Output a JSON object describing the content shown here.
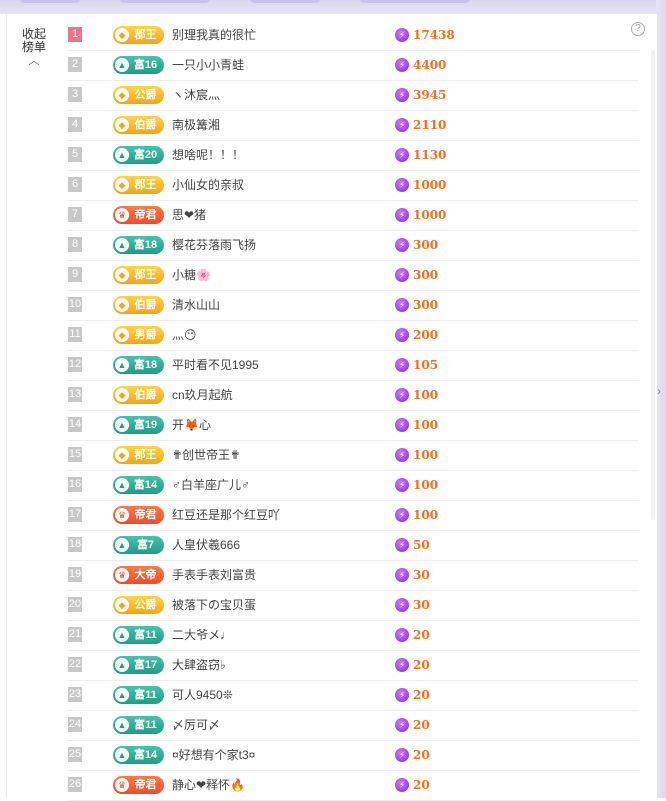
{
  "panel": {
    "collapse_label_1": "收起",
    "collapse_label_2": "榜单",
    "help_glyph": "?"
  },
  "icons": {
    "caret": "up-caret-icon",
    "help": "help-circle-icon",
    "score": "lightning-coin-icon",
    "expand": "chevron-right-icon"
  },
  "colors": {
    "score_text": "#f0701d",
    "rank_top": "#f0728b",
    "badge_gold": "#f3a512",
    "badge_teal": "#1f9d86",
    "badge_red": "#f04a2a"
  },
  "rows": [
    {
      "rank": "1",
      "badge": "郡王",
      "badge_type": "gold",
      "name": "别理我真的很忙",
      "score": "17438"
    },
    {
      "rank": "2",
      "badge": "富16",
      "badge_type": "teal",
      "name": "一只小小青蛙",
      "score": "4400"
    },
    {
      "rank": "3",
      "badge": "公爵",
      "badge_type": "gold",
      "name": "ヽ沐宸灬",
      "score": "3945"
    },
    {
      "rank": "4",
      "badge": "伯爵",
      "badge_type": "gold",
      "name": "南极篝湘",
      "score": "2110"
    },
    {
      "rank": "5",
      "badge": "富20",
      "badge_type": "teal",
      "name": "想啥呢！！！",
      "score": "1130"
    },
    {
      "rank": "6",
      "badge": "郡王",
      "badge_type": "gold",
      "name": "小仙女的亲叔",
      "score": "1000"
    },
    {
      "rank": "7",
      "badge": "帝君",
      "badge_type": "red",
      "name": "思❤猪",
      "score": "1000"
    },
    {
      "rank": "8",
      "badge": "富18",
      "badge_type": "teal",
      "name": "樱花芬落雨飞扬",
      "score": "300"
    },
    {
      "rank": "9",
      "badge": "郡王",
      "badge_type": "gold",
      "name": "小糖🌸",
      "score": "300"
    },
    {
      "rank": "10",
      "badge": "伯爵",
      "badge_type": "gold",
      "name": "清水山山",
      "score": "300"
    },
    {
      "rank": "11",
      "badge": "男爵",
      "badge_type": "gold",
      "name": "灬😶",
      "score": "200"
    },
    {
      "rank": "12",
      "badge": "富18",
      "badge_type": "teal",
      "name": "平时看不见1995",
      "score": "105"
    },
    {
      "rank": "13",
      "badge": "伯爵",
      "badge_type": "gold",
      "name": "cn玖月起航",
      "score": "100"
    },
    {
      "rank": "14",
      "badge": "富19",
      "badge_type": "teal",
      "name": "开🦊心",
      "score": "100"
    },
    {
      "rank": "15",
      "badge": "郡王",
      "badge_type": "gold",
      "name": "✟创世帝王✟",
      "score": "100"
    },
    {
      "rank": "16",
      "badge": "富14",
      "badge_type": "teal",
      "name": "♂白羊座广儿♂",
      "score": "100"
    },
    {
      "rank": "17",
      "badge": "帝君",
      "badge_type": "red",
      "name": "红豆还是那个红豆吖",
      "score": "100"
    },
    {
      "rank": "18",
      "badge": "富7",
      "badge_type": "teal",
      "name": "人皇伏羲666",
      "score": "50"
    },
    {
      "rank": "19",
      "badge": "大帝",
      "badge_type": "red",
      "name": "手表手表刘富贵",
      "score": "30"
    },
    {
      "rank": "20",
      "badge": "公爵",
      "badge_type": "gold",
      "name": "被落下の宝贝蛋",
      "score": "30"
    },
    {
      "rank": "21",
      "badge": "富11",
      "badge_type": "teal",
      "name": "二大爷メ♩",
      "score": "20"
    },
    {
      "rank": "22",
      "badge": "富17",
      "badge_type": "teal",
      "name": "大肆盗窃♭",
      "score": "20"
    },
    {
      "rank": "23",
      "badge": "富11",
      "badge_type": "teal",
      "name": "可人9450❊",
      "score": "20"
    },
    {
      "rank": "24",
      "badge": "富11",
      "badge_type": "teal",
      "name": "〆厉可〆",
      "score": "20"
    },
    {
      "rank": "25",
      "badge": "富14",
      "badge_type": "teal",
      "name": "¤好想有个家t3¤",
      "score": "20"
    },
    {
      "rank": "26",
      "badge": "帝君",
      "badge_type": "red",
      "name": "静心❤释怀🔥",
      "score": "20"
    }
  ]
}
